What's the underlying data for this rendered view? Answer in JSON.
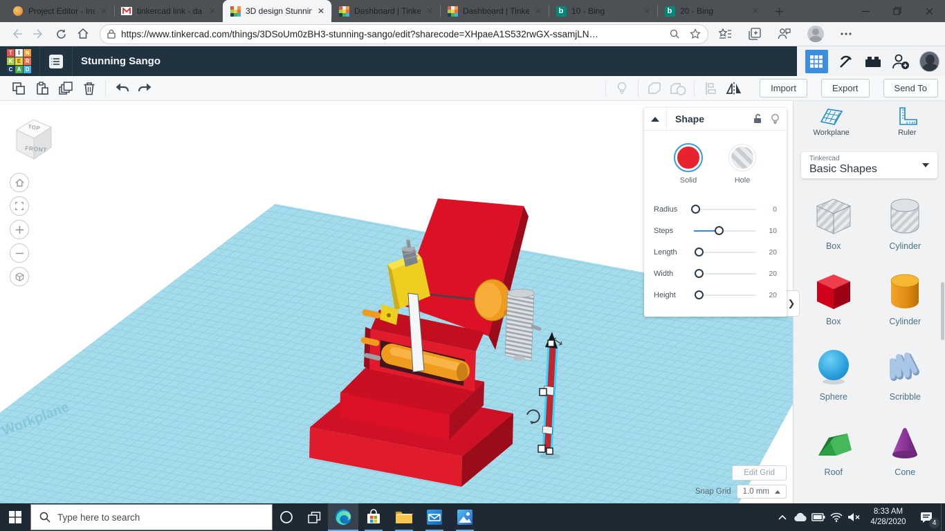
{
  "browser": {
    "tabs": [
      {
        "title": "Project Editor - Ins",
        "icon": "project-editor"
      },
      {
        "title": "tinkercad link - da",
        "icon": "gmail"
      },
      {
        "title": "3D design Stunnin",
        "icon": "tinkercad",
        "active": true
      },
      {
        "title": "Dashboard | Tinke",
        "icon": "tinkercad"
      },
      {
        "title": "Dashboard | Tinke",
        "icon": "tinkercad"
      },
      {
        "title": "10 - Bing",
        "icon": "bing"
      },
      {
        "title": "20 - Bing",
        "icon": "bing"
      }
    ],
    "url": "https://www.tinkercad.com/things/3DSoUm0zBH3-stunning-sango/edit?sharecode=XHpaeA1S532rwGX-ssamjLN…"
  },
  "header": {
    "title": "Stunning Sango"
  },
  "toolbar": {
    "import_label": "Import",
    "export_label": "Export",
    "send_to_label": "Send To"
  },
  "shape_panel": {
    "title": "Shape",
    "solid_label": "Solid",
    "hole_label": "Hole",
    "sliders": [
      {
        "label": "Radius",
        "value": "0"
      },
      {
        "label": "Steps",
        "value": "10"
      },
      {
        "label": "Length",
        "value": "20"
      },
      {
        "label": "Width",
        "value": "20"
      },
      {
        "label": "Height",
        "value": "20"
      }
    ]
  },
  "sidebar": {
    "workplane_label": "Workplane",
    "ruler_label": "Ruler",
    "category_brand": "Tinkercad",
    "category_name": "Basic Shapes",
    "shapes": [
      {
        "label": "Box"
      },
      {
        "label": "Cylinder"
      },
      {
        "label": "Box"
      },
      {
        "label": "Cylinder"
      },
      {
        "label": "Sphere"
      },
      {
        "label": "Scribble"
      },
      {
        "label": "Roof"
      },
      {
        "label": "Cone"
      }
    ]
  },
  "canvas": {
    "viewcube": {
      "top": "TOP",
      "front": "FRONT"
    },
    "watermark": "Workplane",
    "edit_grid_label": "Edit Grid",
    "snap_grid_label": "Snap Grid",
    "snap_grid_value": "1.0 mm"
  },
  "taskbar": {
    "search_placeholder": "Type here to search",
    "time": "8:33 AM",
    "date": "4/28/2020",
    "notification_count": "4"
  },
  "colors": {
    "accent_blue": "#3e8ede",
    "selection_cyan": "#35d6ff",
    "workplane_blue": "#a6dbec",
    "tinkercad_red": "#d0021b",
    "tinkercad_orange": "#f5a623"
  }
}
